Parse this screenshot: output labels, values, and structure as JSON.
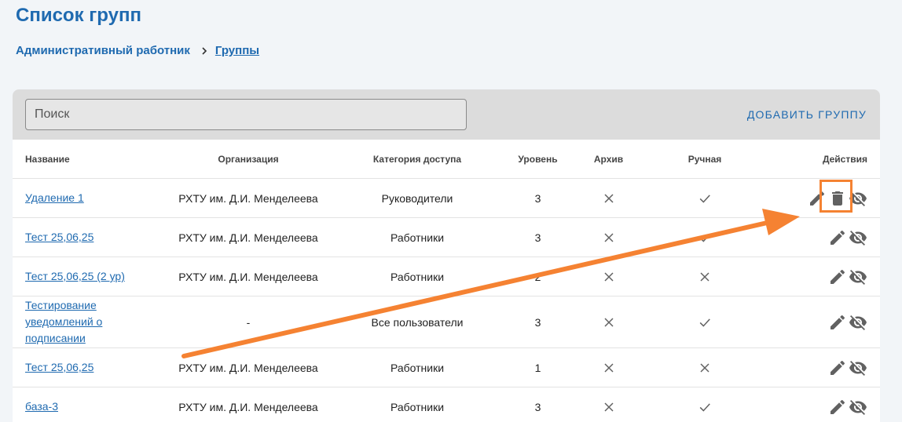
{
  "page": {
    "title": "Список групп"
  },
  "breadcrumb": {
    "parent": "Административный работник",
    "current": "Группы"
  },
  "toolbar": {
    "search_placeholder": "Поиск",
    "add_label": "ДОБАВИТЬ ГРУППУ"
  },
  "table": {
    "columns": [
      "Название",
      "Организация",
      "Категория доступа",
      "Уровень",
      "Архив",
      "Ручная",
      "Действия"
    ],
    "rows": [
      {
        "name": "Удаление 1",
        "org": "РХТУ им. Д.И. Менделеева",
        "category": "Руководители",
        "level": "3",
        "archive": false,
        "manual": true
      },
      {
        "name": "Тест 25,06,25",
        "org": "РХТУ им. Д.И. Менделеева",
        "category": "Работники",
        "level": "3",
        "archive": false,
        "manual": true
      },
      {
        "name": "Тест 25,06,25 (2 ур)",
        "org": "РХТУ им. Д.И. Менделеева",
        "category": "Работники",
        "level": "2",
        "archive": false,
        "manual": false
      },
      {
        "name": "Тестирование уведомлений о подписании",
        "org": "-",
        "category": "Все пользователи",
        "level": "3",
        "archive": false,
        "manual": true
      },
      {
        "name": "Тест 25,06,25",
        "org": "РХТУ им. Д.И. Менделеева",
        "category": "Работники",
        "level": "1",
        "archive": false,
        "manual": false
      },
      {
        "name": "база-3",
        "org": "РХТУ им. Д.И. Менделеева",
        "category": "Работники",
        "level": "3",
        "archive": false,
        "manual": true
      }
    ]
  },
  "icons": {
    "edit": "pencil-icon",
    "delete": "trash-icon",
    "hide": "eye-off-icon",
    "yes": "check-icon",
    "no": "cross-icon"
  },
  "colors": {
    "accent": "#1f6ab0",
    "annotation": "#f58232",
    "icon": "#616161",
    "toolbar_bg": "#dcdcdc",
    "page_bg": "#f2f5f8"
  }
}
